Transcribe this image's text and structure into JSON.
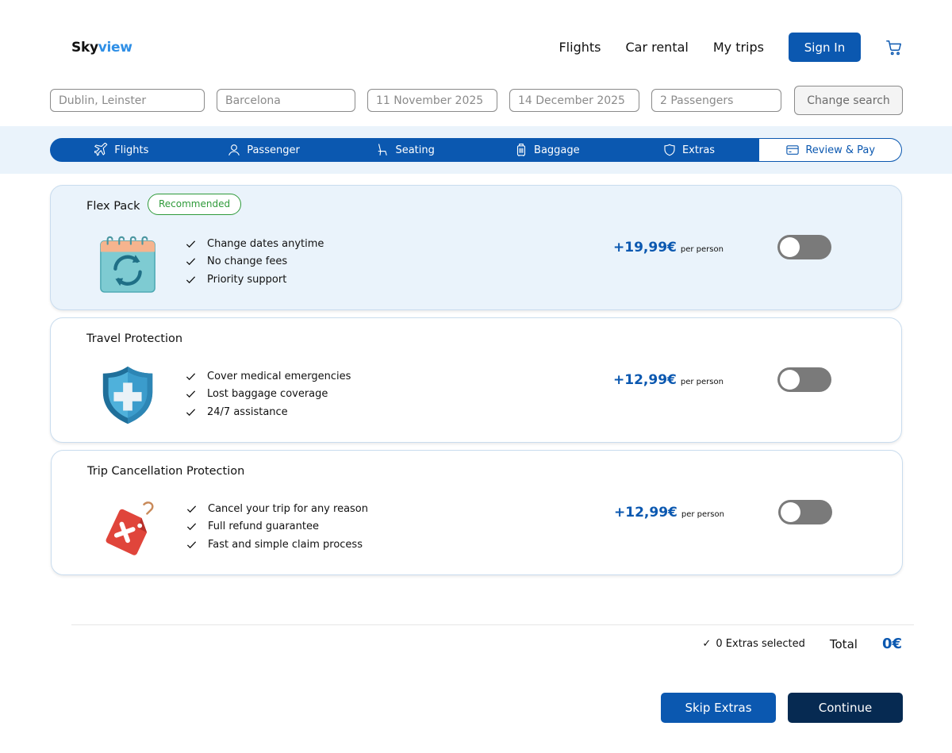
{
  "brand": {
    "part1": "Sky",
    "part2": "view",
    "accent": "#2f8fe6"
  },
  "nav": {
    "links": [
      "Flights",
      "Car rental",
      "My trips"
    ],
    "signin_label": "Sign In",
    "cart_icon": "cart-icon"
  },
  "search": {
    "origin": "Dublin, Leinster",
    "destination": "Barcelona",
    "depart": "11 November 2025",
    "return": "14 December 2025",
    "passengers": "2 Passengers",
    "change_label": "Change search"
  },
  "steps": [
    {
      "label": "Flights",
      "icon": "plane-icon"
    },
    {
      "label": "Passenger",
      "icon": "user-icon"
    },
    {
      "label": "Seating",
      "icon": "seat-icon"
    },
    {
      "label": "Baggage",
      "icon": "luggage-icon"
    },
    {
      "label": "Extras",
      "icon": "shield-icon"
    },
    {
      "label": "Review & Pay",
      "icon": "card-icon",
      "active": true
    }
  ],
  "extras": [
    {
      "title": "Flex Pack",
      "badge": "Recommended",
      "icon": "calendar-refresh-icon",
      "features": [
        "Change dates anytime",
        "No change fees",
        "Priority support"
      ],
      "price": "+19,99€",
      "unit": "per person",
      "enabled": false
    },
    {
      "title": "Travel Protection",
      "icon": "medical-shield-icon",
      "features": [
        "Cover medical emergencies",
        "Lost baggage coverage",
        "24/7 assistance"
      ],
      "price": "+12,99€",
      "unit": "per person",
      "enabled": false
    },
    {
      "title": "Trip Cancellation Protection",
      "icon": "cancel-tag-icon",
      "features": [
        "Cancel your trip for any reason",
        "Full refund guarantee",
        "Fast and simple claim process"
      ],
      "price": "+12,99€",
      "unit": "per person",
      "enabled": false
    }
  ],
  "summary": {
    "extras_selected": "0 Extras selected",
    "total_label": "Total",
    "total_value": "0€"
  },
  "actions": {
    "skip_label": "Skip Extras",
    "continue_label": "Continue"
  },
  "colors": {
    "primary": "#0b58b0",
    "dark": "#062a52",
    "highlight_bg": "#eaf3fb",
    "badge_green": "#2f9a3a"
  }
}
